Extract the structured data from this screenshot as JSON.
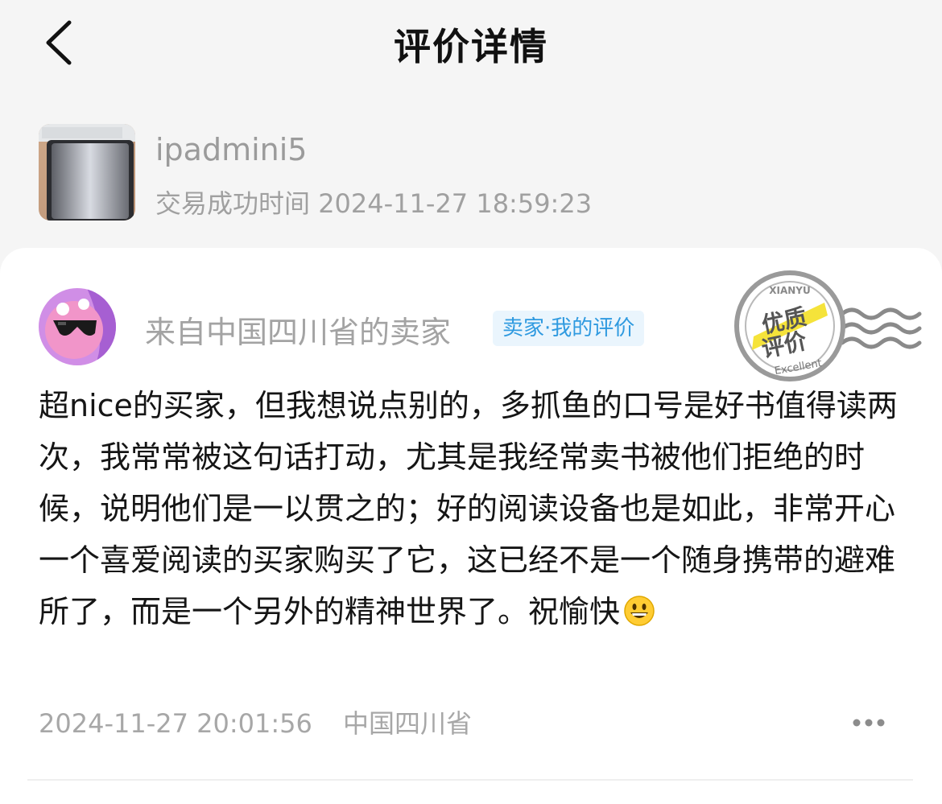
{
  "header": {
    "title": "评价详情",
    "back_icon": "chevron-left-icon"
  },
  "product": {
    "name": "ipadmini5",
    "time_label": "交易成功时间",
    "time_value": "2024-11-27 18:59:23"
  },
  "review": {
    "user_name": "来自中国四川省的卖家",
    "role_badge": "卖家·我的评价",
    "stamp": {
      "top_text": "XIANYU",
      "line1": "优质",
      "line2": "评价",
      "bottom_text": "Excellent"
    },
    "content": "超nice的买家，但我想说点别的，多抓鱼的口号是好书值得读两次，我常常被这句话打动，尤其是我经常卖书被他们拒绝的时候，说明他们是一以贯之的；好的阅读设备也是如此，非常开心一个喜爱阅读的买家购买了它，这已经不是一个随身携带的避难所了，而是一个另外的精神世界了。祝愉快",
    "emoji": "grinning-face-emoji",
    "time": "2024-11-27 20:01:56",
    "location": "中国四川省",
    "more_icon": "more-dots-icon"
  },
  "colors": {
    "page_bg": "#f5f5f5",
    "card_bg": "#ffffff",
    "badge_text": "#2f9ae0",
    "badge_bg": "#eaf5fd",
    "muted_text": "#a3a3a3",
    "stamp_highlight": "#f5e33a"
  }
}
